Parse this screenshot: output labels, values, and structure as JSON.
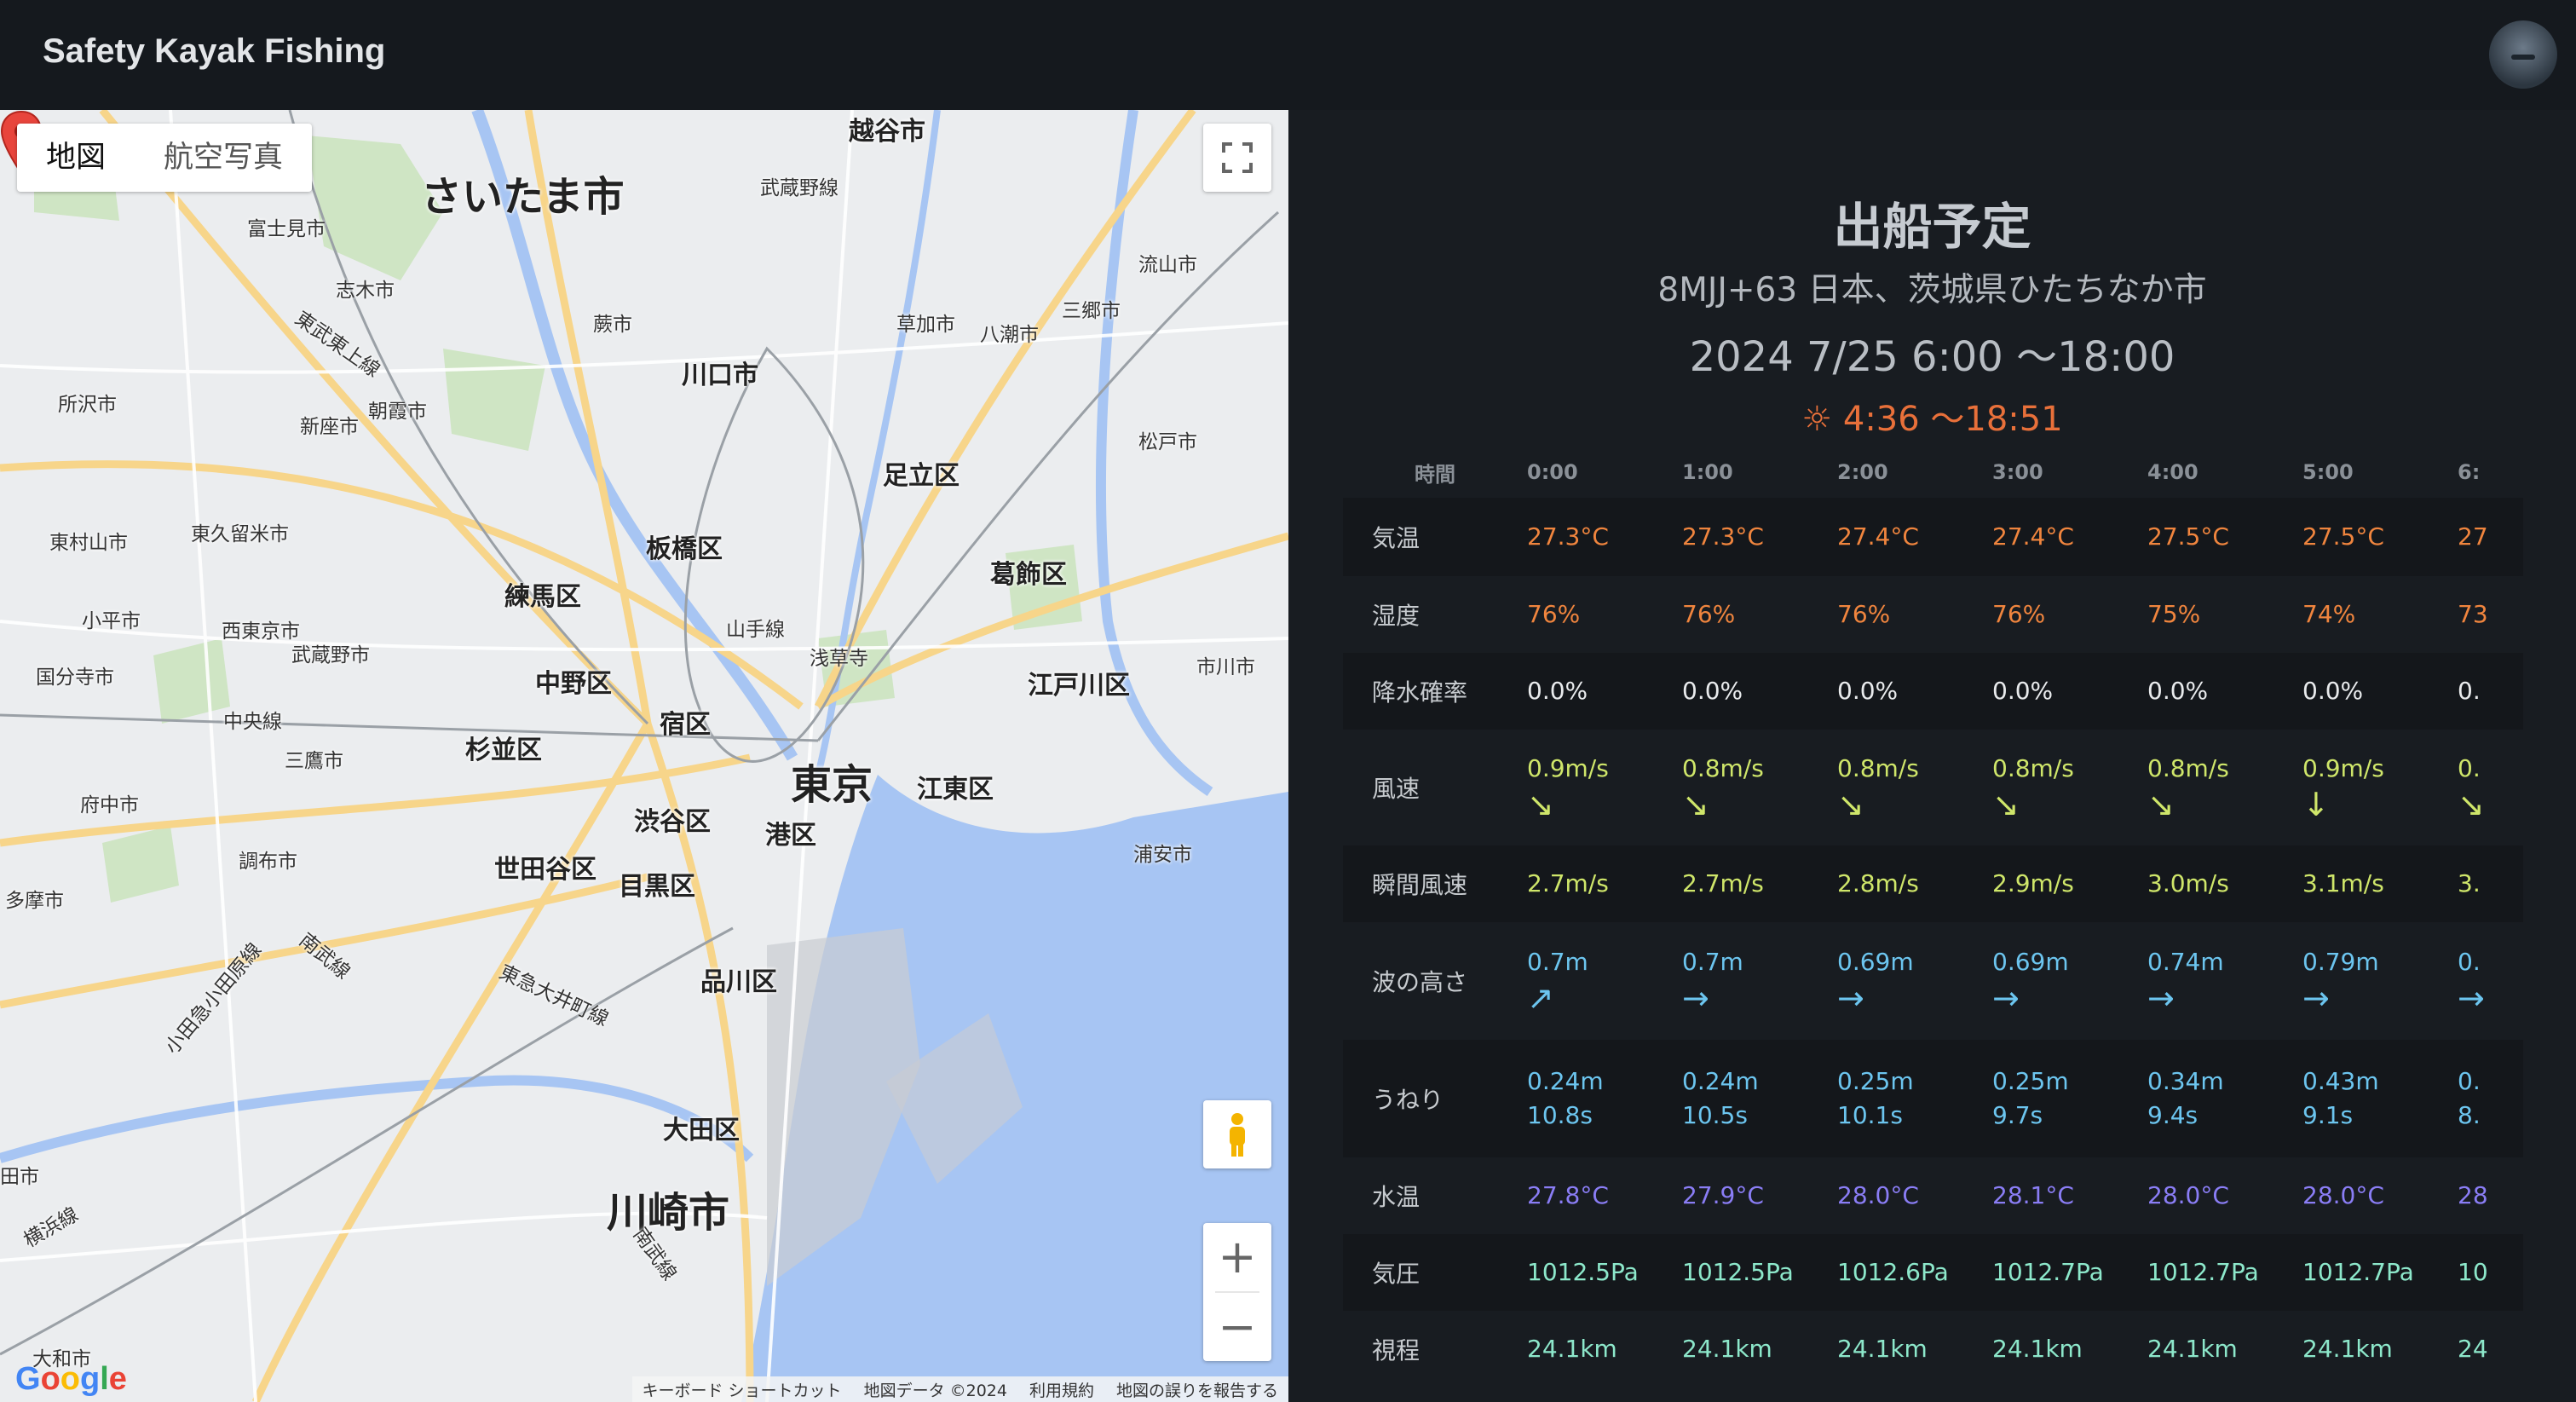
{
  "app": {
    "title": "Safety Kayak Fishing"
  },
  "map": {
    "type_buttons": [
      "地図",
      "航空写真"
    ],
    "labels": {
      "saitama": "さいたま市",
      "tokyo": "東京",
      "kawasaki": "川崎市",
      "kawaguchi": "川口市",
      "adachi": "足立区",
      "itabashi": "板橋区",
      "nerima": "練馬区",
      "katsushika": "葛飾区",
      "nakano": "中野区",
      "shinjuku": "宿区",
      "suginami": "杉並区",
      "edogawa": "江戸川区",
      "koto": "江東区",
      "shibuya": "渋谷区",
      "minato": "港区",
      "setagaya": "世田谷区",
      "meguro": "目黒区",
      "shinagawa": "品川区",
      "ota": "大田区",
      "koshigaya": "越谷市",
      "asakusa": "浅草寺",
      "fujimi": "富士見市",
      "shiki": "志木市",
      "tokorozawa": "所沢市",
      "niiza": "新座市",
      "asaka": "朝霞市",
      "warabi": "蕨市",
      "soka": "草加市",
      "yashio": "八潮市",
      "misato": "三郷市",
      "nagareyama": "流山市",
      "matsudo": "松戸市",
      "higashimurayama": "東村山市",
      "higashikurume": "東久留米市",
      "kodaira": "小平市",
      "nishitokyo": "西東京市",
      "musashino": "武蔵野市",
      "kokubunji": "国分寺市",
      "mitaka": "三鷹市",
      "fuchu": "府中市",
      "chofu": "調布市",
      "tama": "多摩市",
      "ichikawa": "市川市",
      "urayasu": "浦安市",
      "yamanote": "山手線",
      "chuosen": "中央線",
      "musashinosen": "武蔵野線",
      "tobutojo": "東武東上線",
      "nambusen": "南武線",
      "tokyu": "東急大井町線",
      "odakyu": "小田急小田原線",
      "yokohamasen": "横浜線",
      "owada": "大和市",
      "nambu2": "南武線",
      "yokosuka": "田市"
    },
    "controls": {
      "zoom_in": "+",
      "zoom_out": "−"
    },
    "google_logo": "Google",
    "attribution": [
      "キーボード ショートカット",
      "地図データ ©2024",
      "利用規約",
      "地図の誤りを報告する"
    ]
  },
  "panel": {
    "title": "出船予定",
    "location": "8MJJ+63 日本、茨城県ひたちなか市",
    "time_range": "2024 7/25 6:00 〜18:00",
    "sun_icon": "☼",
    "sun_times": "4:36 〜18:51",
    "header_label": "時間",
    "hours": [
      "0:00",
      "1:00",
      "2:00",
      "3:00",
      "4:00",
      "5:00",
      "6:"
    ],
    "rows": [
      {
        "label": "気温",
        "color": "#f0853e",
        "values": [
          [
            "27.3°C"
          ],
          [
            "27.3°C"
          ],
          [
            "27.4°C"
          ],
          [
            "27.4°C"
          ],
          [
            "27.5°C"
          ],
          [
            "27.5°C"
          ],
          [
            "27"
          ]
        ]
      },
      {
        "label": "湿度",
        "color": "#f0853e",
        "values": [
          [
            "76%"
          ],
          [
            "76%"
          ],
          [
            "76%"
          ],
          [
            "76%"
          ],
          [
            "75%"
          ],
          [
            "74%"
          ],
          [
            "73"
          ]
        ]
      },
      {
        "label": "降水確率",
        "color": "#e9ebed",
        "values": [
          [
            "0.0%"
          ],
          [
            "0.0%"
          ],
          [
            "0.0%"
          ],
          [
            "0.0%"
          ],
          [
            "0.0%"
          ],
          [
            "0.0%"
          ],
          [
            "0."
          ]
        ]
      },
      {
        "label": "風速",
        "color": "#cfe66a",
        "values": [
          [
            "0.9m/s",
            "↘"
          ],
          [
            "0.8m/s",
            "↘"
          ],
          [
            "0.8m/s",
            "↘"
          ],
          [
            "0.8m/s",
            "↘"
          ],
          [
            "0.8m/s",
            "↘"
          ],
          [
            "0.9m/s",
            "↓"
          ],
          [
            "0.",
            "↘"
          ]
        ]
      },
      {
        "label": "瞬間風速",
        "color": "#cfe66a",
        "values": [
          [
            "2.7m/s"
          ],
          [
            "2.7m/s"
          ],
          [
            "2.8m/s"
          ],
          [
            "2.9m/s"
          ],
          [
            "3.0m/s"
          ],
          [
            "3.1m/s"
          ],
          [
            "3."
          ]
        ]
      },
      {
        "label": "波の高さ",
        "color": "#6cc5ef",
        "values": [
          [
            "0.7m",
            "↗"
          ],
          [
            "0.7m",
            "→"
          ],
          [
            "0.69m",
            "→"
          ],
          [
            "0.69m",
            "→"
          ],
          [
            "0.74m",
            "→"
          ],
          [
            "0.79m",
            "→"
          ],
          [
            "0.",
            "→"
          ]
        ]
      },
      {
        "label": "うねり",
        "color": "#6cc5ef",
        "values": [
          [
            "0.24m",
            "10.8s"
          ],
          [
            "0.24m",
            "10.5s"
          ],
          [
            "0.25m",
            "10.1s"
          ],
          [
            "0.25m",
            "9.7s"
          ],
          [
            "0.34m",
            "9.4s"
          ],
          [
            "0.43m",
            "9.1s"
          ],
          [
            "0.",
            "8."
          ]
        ]
      },
      {
        "label": "水温",
        "color": "#8a7df5",
        "values": [
          [
            "27.8°C"
          ],
          [
            "27.9°C"
          ],
          [
            "28.0°C"
          ],
          [
            "28.1°C"
          ],
          [
            "28.0°C"
          ],
          [
            "28.0°C"
          ],
          [
            "28"
          ]
        ]
      },
      {
        "label": "気圧",
        "color": "#8de8cb",
        "values": [
          [
            "1012.5Pa"
          ],
          [
            "1012.5Pa"
          ],
          [
            "1012.6Pa"
          ],
          [
            "1012.7Pa"
          ],
          [
            "1012.7Pa"
          ],
          [
            "1012.7Pa"
          ],
          [
            "10"
          ]
        ]
      },
      {
        "label": "視程",
        "color": "#8de8cb",
        "values": [
          [
            "24.1km"
          ],
          [
            "24.1km"
          ],
          [
            "24.1km"
          ],
          [
            "24.1km"
          ],
          [
            "24.1km"
          ],
          [
            "24.1km"
          ],
          [
            "24"
          ]
        ]
      }
    ]
  }
}
